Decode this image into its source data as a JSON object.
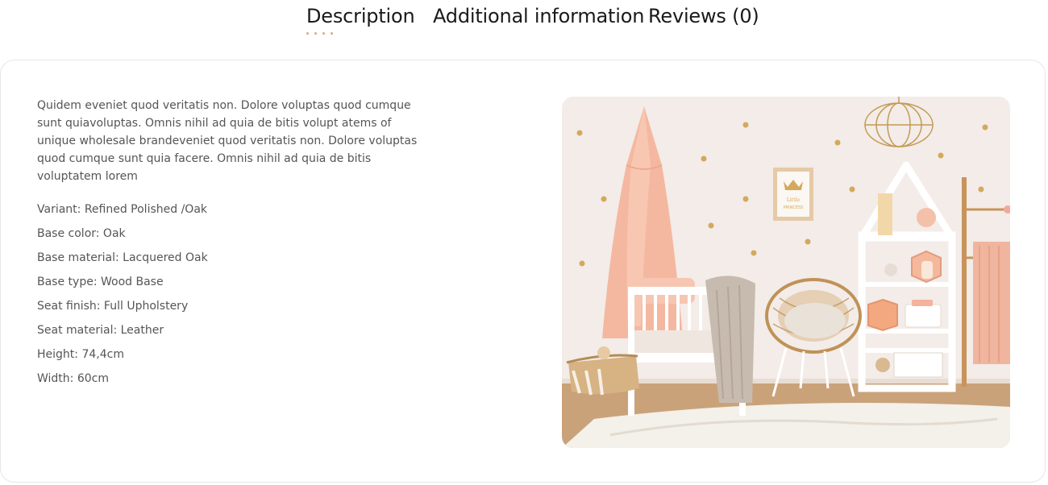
{
  "tabs": [
    {
      "label": "Description",
      "active": true
    },
    {
      "label": "Additional information",
      "active": false
    },
    {
      "label": "Reviews (0)",
      "active": false
    }
  ],
  "colors": {
    "accent_dots": "#e0a583",
    "text_muted": "#555555",
    "panel_border": "#e6e6e6"
  },
  "description": {
    "paragraph": "Quidem eveniet quod veritatis non. Dolore voluptas quod cumque sunt quiavoluptas. Omnis nihil ad quia de bitis volupt atems of unique wholesale brandeveniet quod veritatis non. Dolore voluptas quod cumque sunt quia facere. Omnis nihil ad quia de bitis voluptatem lorem",
    "specs": [
      "Variant: Refined Polished /Oak",
      "Base color: Oak",
      "Base material: Lacquered Oak",
      "Base type: Wood Base",
      "Seat finish: Full Upholstery",
      "Seat material: Leather",
      "Height: 74,4cm",
      "Width: 60cm"
    ]
  },
  "image": {
    "frame_text": "Little PRINCESS"
  }
}
